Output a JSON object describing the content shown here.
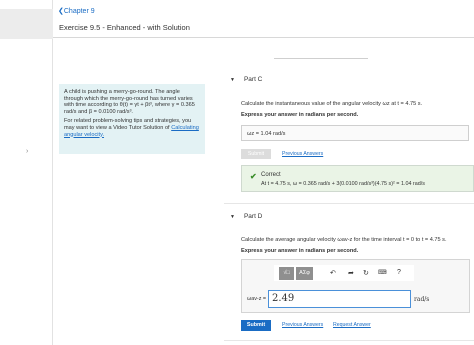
{
  "nav": {
    "back_label": "Chapter 9",
    "back_icon": "chevron-left-icon",
    "collapse_icon": "chevron-right-icon"
  },
  "exercise": {
    "title": "Exercise 9.5 - Enhanced - with Solution"
  },
  "problem": {
    "text": "A child is pushing a merry-go-round. The angle through which the merry-go-round has turned varies with time according to θ(t) = γt + βt³, where γ = 0.365 rad/s and β = 0.0100 rad/s³.",
    "tips_text": "For related problem-solving tips and strategies, you may want to view a Video Tutor Solution of",
    "tips_link": "Calculating angular velocity."
  },
  "part_c": {
    "label": "Part C",
    "question": "Calculate the instantaneous value of the angular velocity ωz at t = 4.75 s.",
    "instruction": "Express your answer in radians per second.",
    "answer": "ωz = 1.04 rad/s",
    "submit_label": "Submit",
    "prev_answers_label": "Previous Answers",
    "status": "Correct",
    "detail": "At t = 4.75 s, ω = 0.365 rad/s + 3(0.0100 rad/s³)(4.75 s)² = 1.04 rad/s"
  },
  "part_d": {
    "label": "Part D",
    "question": "Calculate the average angular velocity ωav-z for the time interval t = 0 to t = 4.75 s.",
    "instruction": "Express your answer in radians per second.",
    "toolbar": {
      "template_label": "ΑΣφ",
      "fraction_label": "√□",
      "help_label": "?"
    },
    "input_label": "ωav-z =",
    "input_value": "2.49",
    "units": "rad/s",
    "submit_label": "Submit",
    "prev_answers_label": "Previous Answers",
    "request_answer_label": "Request Answer"
  },
  "colors": {
    "accent": "#1a6cc4",
    "tip_bg": "#e3f2f4",
    "correct_bg": "#eaf4e6",
    "check": "#3a8d2a"
  }
}
